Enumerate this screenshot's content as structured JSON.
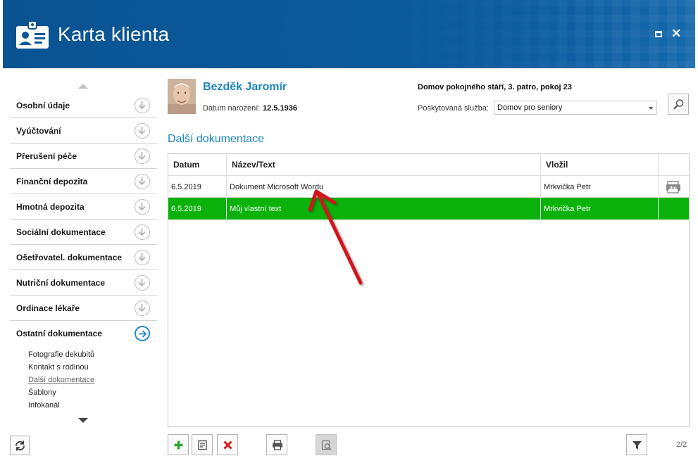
{
  "window": {
    "title": "Karta klienta",
    "icons": {
      "app": "id-card-icon",
      "maximize": "maximize-icon",
      "close": "close-icon"
    },
    "close_glyph": "✕"
  },
  "client": {
    "name": "Bezděk Jaromír",
    "dob_label": "Datum narození:",
    "dob_value": "12.5.1936",
    "facility": "Domov pokojného stáří, 3. patro, pokoj 23",
    "service_label": "Poskytovaná služba:",
    "service_value": "Domov pro seniory"
  },
  "sidebar": {
    "items": [
      {
        "label": "Osobní údaje"
      },
      {
        "label": "Vyúčtování"
      },
      {
        "label": "Přerušení péče"
      },
      {
        "label": "Finanční depozita"
      },
      {
        "label": "Hmotná depozita"
      },
      {
        "label": "Sociální dokumentace"
      },
      {
        "label": "Ošetřovatel. dokumentace"
      },
      {
        "label": "Nutriční dokumentace"
      },
      {
        "label": "Ordinace lékaře"
      },
      {
        "label": "Ostatní dokumentace",
        "active": true
      }
    ],
    "subitems": [
      {
        "label": "Fotografie dekubitů"
      },
      {
        "label": "Kontakt s rodinou"
      },
      {
        "label": "Další dokumentace",
        "current": true
      },
      {
        "label": "Šablony"
      },
      {
        "label": "Infokanál"
      }
    ]
  },
  "section": {
    "title": "Další dokumentace"
  },
  "table": {
    "headers": [
      "Datum",
      "Název/Text",
      "Vložil",
      ""
    ],
    "rows": [
      {
        "date": "6.5.2019",
        "name": "Dokument Microsoft Wordu",
        "author": "Mrkvička Petr",
        "doc_badge": "doc"
      },
      {
        "date": "6.5.2019",
        "name": "Můj vlastní text",
        "author": "Mrkvička Petr",
        "selected": true
      }
    ]
  },
  "footer": {
    "page": "2/2"
  },
  "colors": {
    "header_bg": "#0a5797",
    "accent_blue": "#1c86c5",
    "selected_row": "#0bb20b",
    "add_green": "#2fa82f",
    "delete_red": "#d81e1e",
    "annotation_red": "#d0141b"
  }
}
